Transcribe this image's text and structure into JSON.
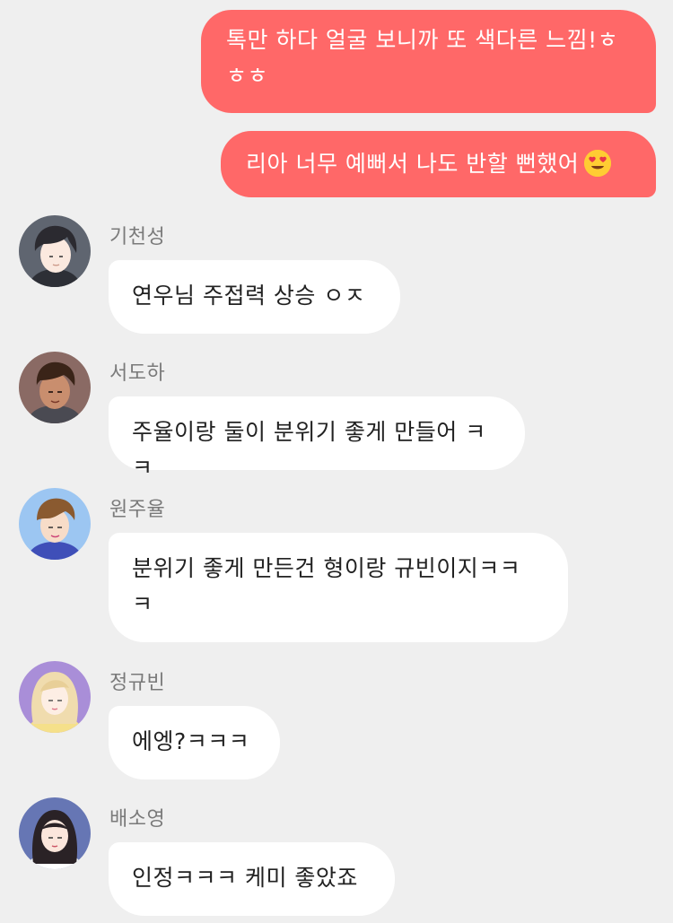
{
  "outgoing": [
    {
      "text": "톡만 하다 얼굴 보니까 또 색다른 느낌!ㅎㅎㅎ"
    },
    {
      "text": "리아 너무 예뻐서 나도 반할 뻔했어",
      "emoji": "heart-eyes-emoji"
    }
  ],
  "incoming": [
    {
      "sender": "기천성",
      "text": "연우님 주접력 상승 ㅇㅈ",
      "avatar": "avatar-gicheonseong"
    },
    {
      "sender": "서도하",
      "text": "주율이랑 둘이 분위기 좋게 만들어 ㅋㅋ",
      "avatar": "avatar-seodoha"
    },
    {
      "sender": "원주율",
      "text": "분위기 좋게 만든건 형이랑 규빈이지ㅋㅋㅋ",
      "avatar": "avatar-wonjuyul"
    },
    {
      "sender": "정규빈",
      "text": "에엥?ㅋㅋㅋ",
      "avatar": "avatar-jeonggyubin"
    },
    {
      "sender": "배소영",
      "text": "인정ㅋㅋㅋ 케미 좋았죠",
      "avatar": "avatar-baesoyoung"
    }
  ],
  "colors": {
    "outgoing_bubble": "#ff6868",
    "incoming_bubble": "#ffffff",
    "background": "#efefef",
    "sender_name": "#7a7a7a"
  }
}
